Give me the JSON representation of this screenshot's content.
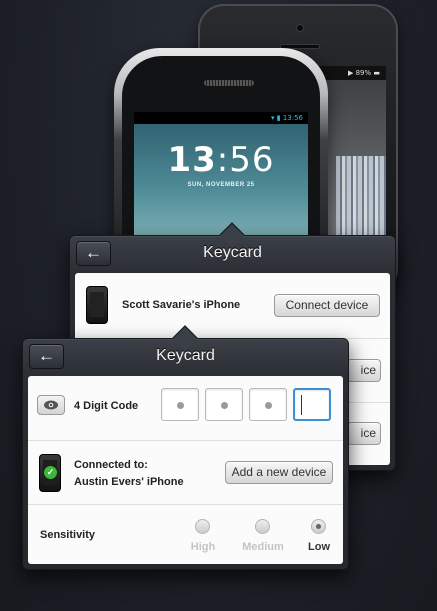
{
  "devices": {
    "iphone_status": "▶ 89% ▬",
    "android_status": "▾ ▮ 13:56",
    "clock_hour": "13",
    "clock_minute": ":56",
    "clock_date": "SUN, NOVEMBER 25"
  },
  "back_popover": {
    "title": "Keycard",
    "back_glyph": "←",
    "device_name": "Scott Savarie's iPhone",
    "connect_label": "Connect device",
    "partial_button_1": "ice",
    "partial_button_2": "ice"
  },
  "front_popover": {
    "title": "Keycard",
    "back_glyph": "←",
    "code": {
      "label": "4 Digit Code",
      "digits_filled": 3,
      "digits_total": 4
    },
    "connection": {
      "label_line1": "Connected to:",
      "label_line2": "Austin Evers' iPhone",
      "add_label": "Add a new device"
    },
    "sensitivity": {
      "label": "Sensitivity",
      "options": [
        "High",
        "Medium",
        "Low"
      ],
      "selected": "Low"
    }
  },
  "colors": {
    "accent_blue": "#3b8fd8",
    "success_green": "#3fb73a"
  }
}
